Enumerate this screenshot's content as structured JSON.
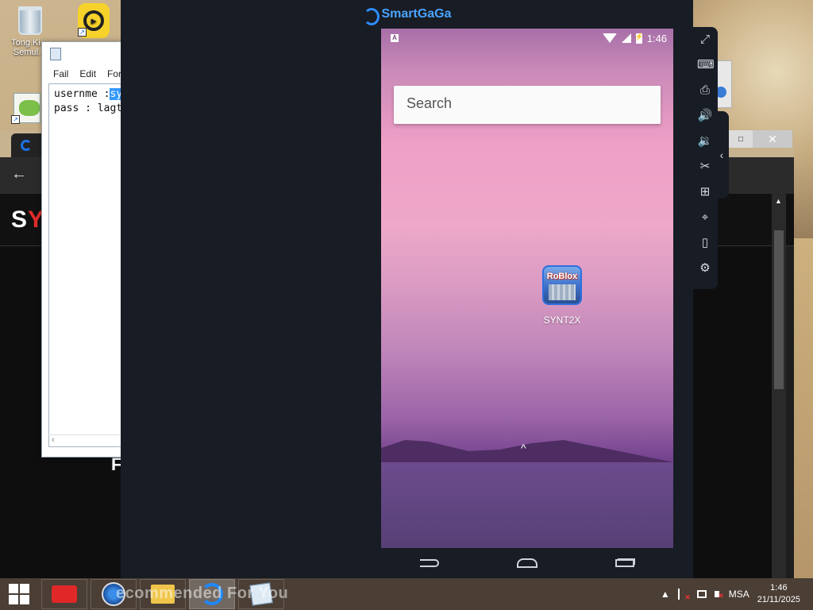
{
  "desktop": {
    "icons": [
      {
        "label": "Tong Ki… Semul…"
      },
      {
        "label": ""
      },
      {
        "label": ""
      }
    ]
  },
  "notepad": {
    "menu": [
      "Fail",
      "Edit",
      "For"
    ],
    "line1_prefix": "usernme :",
    "line1_selected": "sy",
    "line2": "pass : lagt"
  },
  "browser": {
    "logo_white": "S",
    "logo_red": "Y",
    "section_letter": "F",
    "window_close": "✕",
    "window_maximize": "□",
    "kebab": "⋮"
  },
  "emulator": {
    "title": "SmartGaGa",
    "status": {
      "time": "1:46",
      "badge": "A"
    },
    "search_placeholder": "Search",
    "app": {
      "label": "SYNT2X",
      "icon_text": "RoBlox"
    },
    "drawer_arrow": "^",
    "sidebar": [
      {
        "name": "fullscreen-icon",
        "glyph": "⤢"
      },
      {
        "name": "keyboard-icon",
        "glyph": "⌨"
      },
      {
        "name": "apk-install-icon",
        "glyph": "⎙"
      },
      {
        "name": "volume-up-icon",
        "glyph": "🔊"
      },
      {
        "name": "volume-down-icon",
        "glyph": "🔉"
      },
      {
        "name": "scissors-icon",
        "glyph": "✂"
      },
      {
        "name": "multi-instance-icon",
        "glyph": "⊞"
      },
      {
        "name": "location-icon",
        "glyph": "⌖"
      },
      {
        "name": "shake-icon",
        "glyph": "▯"
      },
      {
        "name": "settings-icon",
        "glyph": "⚙"
      }
    ],
    "collapse_arrow": "‹"
  },
  "taskbar": {
    "overlay_text": "ecommended For You",
    "tray": {
      "language": "MSA",
      "time": "1:46",
      "date": "21/11/2025",
      "up_arrow": "▲"
    }
  },
  "colors": {
    "accent": "#2f8cff",
    "taskbar": "#4a3e35",
    "emulator_bg": "#181c24"
  }
}
